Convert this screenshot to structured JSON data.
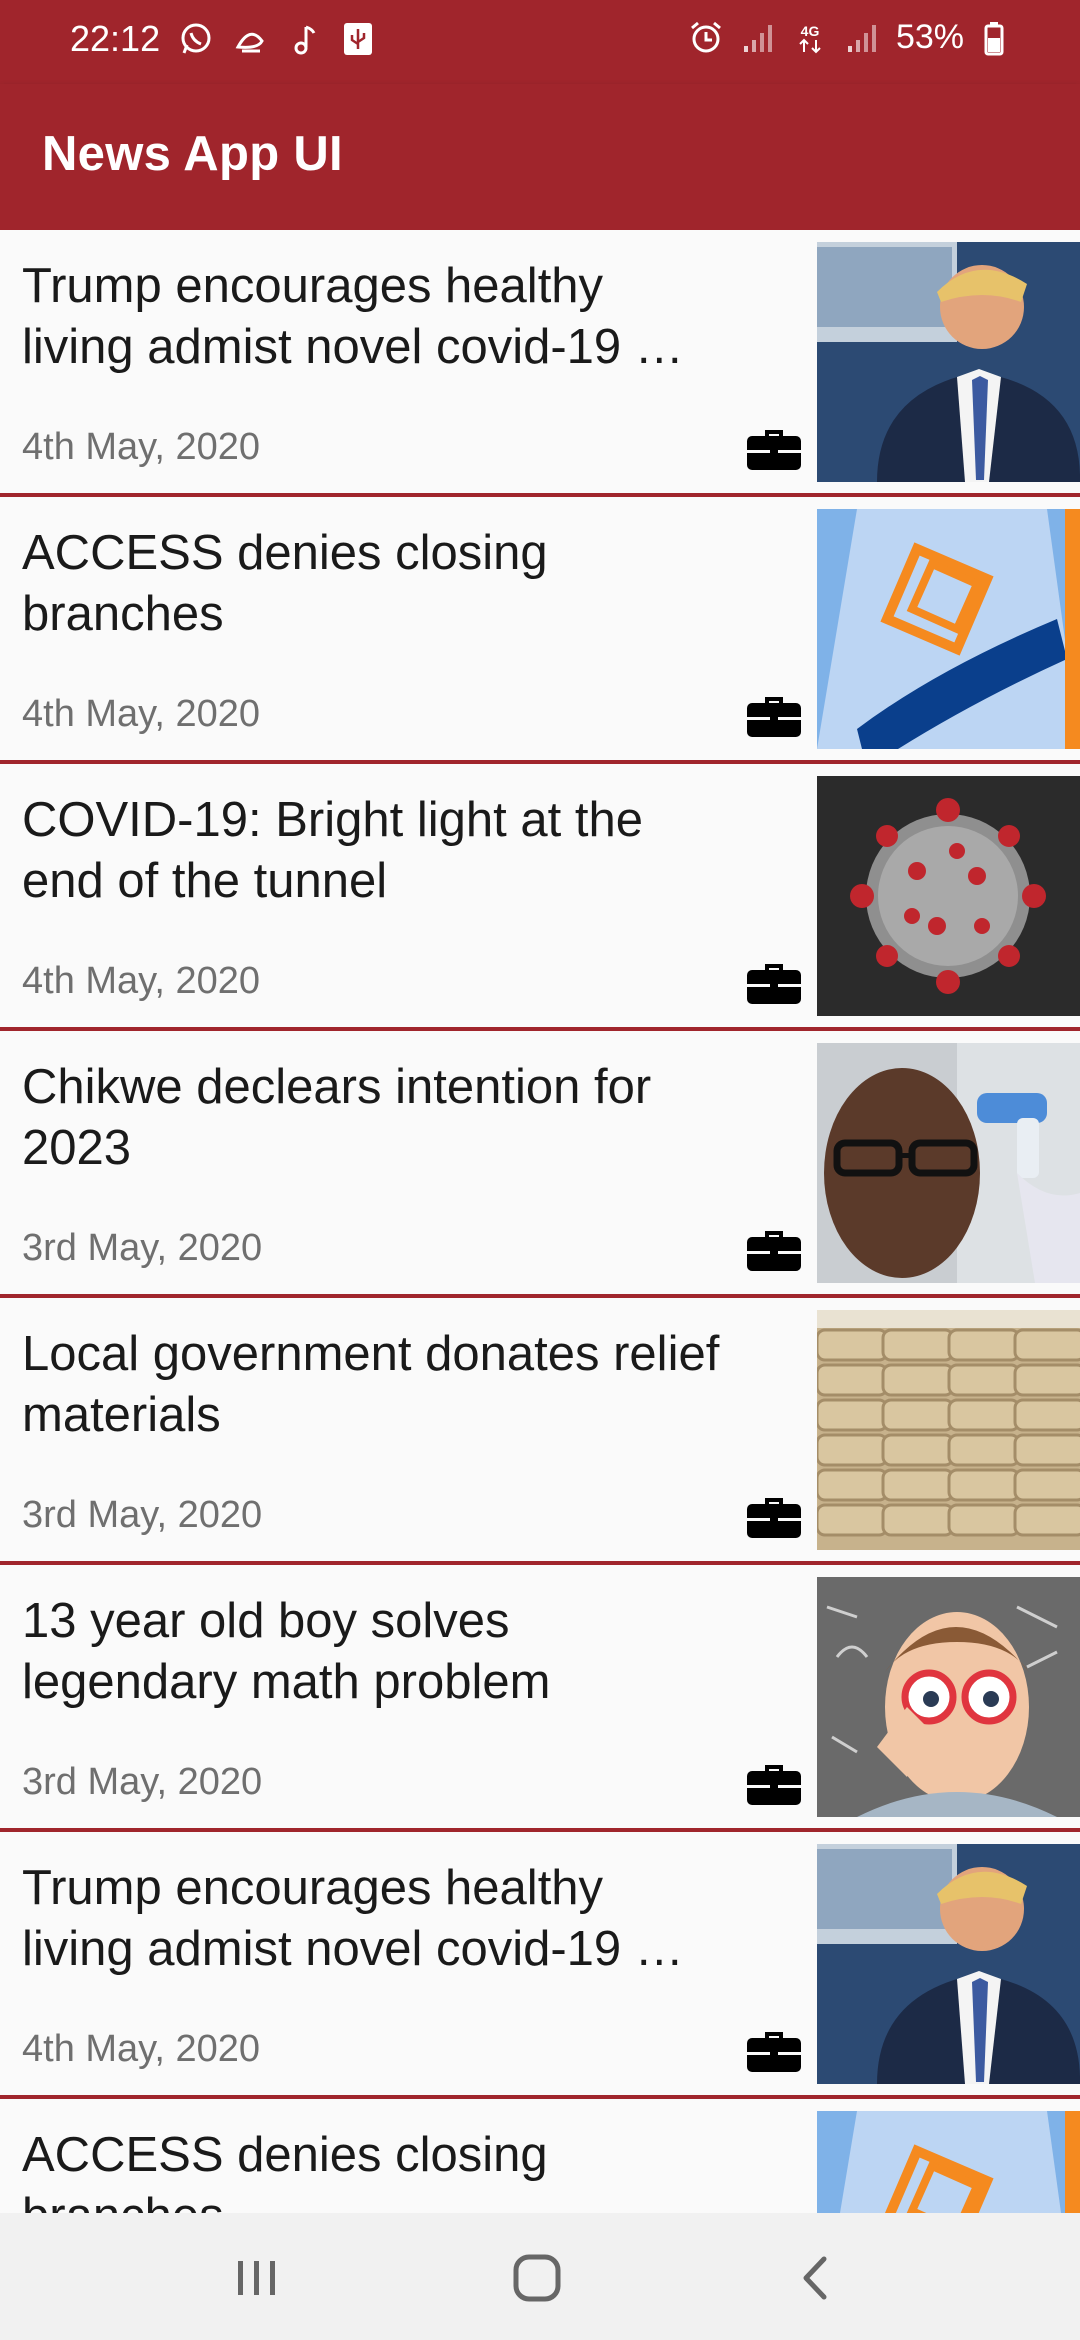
{
  "status_bar": {
    "time": "22:12",
    "battery": "53%",
    "network": "4G",
    "icons_left": [
      "whatsapp-icon",
      "notification-icon",
      "music-note-icon",
      "usb-icon"
    ],
    "icons_right": [
      "alarm-icon",
      "signal-icon",
      "network-4g-icon",
      "signal-icon",
      "battery-icon"
    ]
  },
  "app_bar": {
    "title": "News App UI"
  },
  "news": [
    {
      "title": "Trump encourages healthy living admist novel covid-19 …",
      "date": "4th May, 2020",
      "image": "trump"
    },
    {
      "title": "ACCESS denies closing branches",
      "date": "4th May, 2020",
      "image": "access-logo"
    },
    {
      "title": "COVID-19: Bright light at the end of the tunnel",
      "date": "4th May, 2020",
      "image": "coronavirus"
    },
    {
      "title": "Chikwe declears intention for 2023",
      "date": "3rd May, 2020",
      "image": "man-thermometer"
    },
    {
      "title": "Local government donates relief materials",
      "date": "3rd May, 2020",
      "image": "rice-bags"
    },
    {
      "title": "13 year old boy solves legendary math problem",
      "date": "3rd May, 2020",
      "image": "boy-glasses"
    },
    {
      "title": "Trump encourages healthy living admist novel covid-19 …",
      "date": "4th May, 2020",
      "image": "trump"
    },
    {
      "title": "ACCESS denies closing branches",
      "date": "",
      "image": "access-logo"
    }
  ],
  "nav_bar": {
    "buttons": [
      "recent-apps-icon",
      "home-icon",
      "back-icon"
    ]
  },
  "colors": {
    "primary": "#a0252c",
    "background": "#fafafa",
    "date_text": "#6f6f6f",
    "nav_bar": "#f1f1f1"
  }
}
